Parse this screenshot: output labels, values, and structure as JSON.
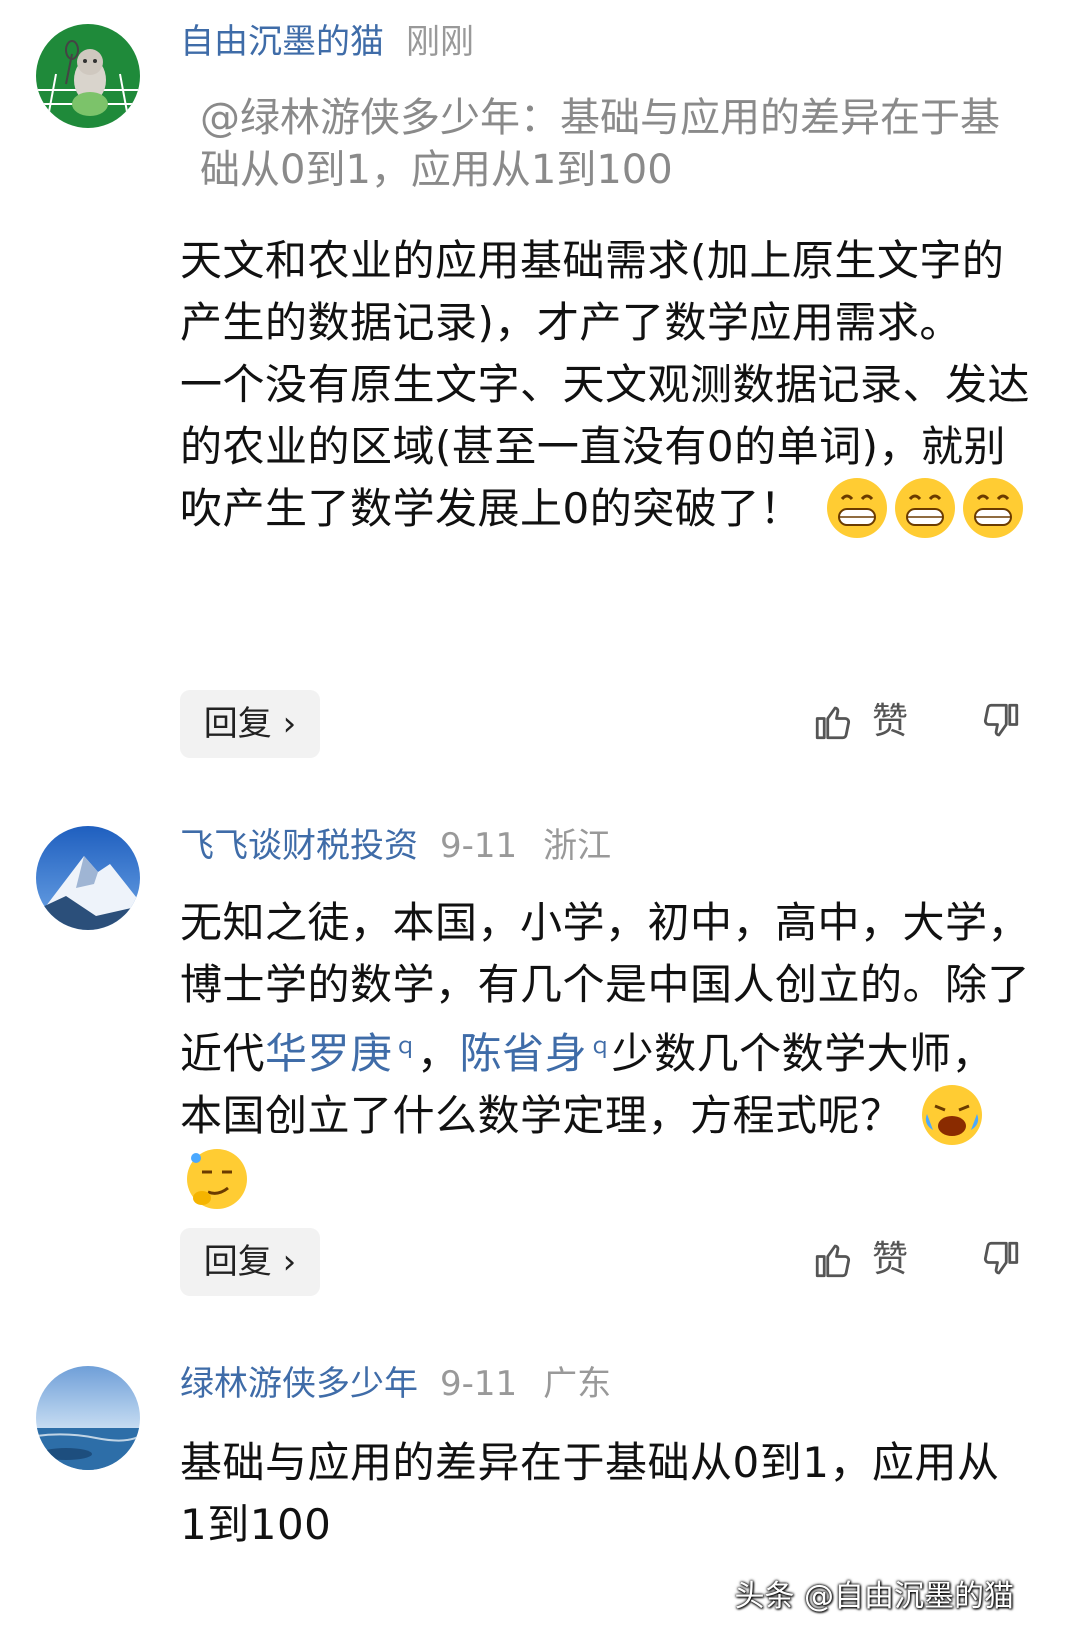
{
  "comments": [
    {
      "name": "自由沉墨的猫",
      "time": "刚刚",
      "quote": "@绿林游侠多少年：基础与应用的差异在于基础从0到1，应用从1到100",
      "body": "天文和农业的应用基础需求(加上原生文字的产生的数据记录)，才产了数学应用需求。\n一个没有原生文字、天文观测数据记录、发达的农业的区域(甚至一直没有0的单词)，就别吹产生了数学发展上0的突破了！",
      "reply_label": "回复",
      "like_label": "赞",
      "emojis": [
        "grin-emoji",
        "grin-emoji",
        "grin-emoji"
      ]
    },
    {
      "name": "飞飞谈财税投资",
      "time": "9-11",
      "region": "浙江",
      "body_before": "无知之徒，本国，小学，初中，高中，大学，博士学的数学，有几个是中国人创立的。除了近代",
      "link1": "华罗庚",
      "sep": "，",
      "link2": "陈省身",
      "body_after": "少数几个数学大师，本国创立了什么数学定理，方程式呢？",
      "reply_label": "回复",
      "like_label": "赞",
      "emojis": [
        "laugh-cry-emoji",
        "smug-emoji"
      ]
    },
    {
      "name": "绿林游侠多少年",
      "time": "9-11",
      "region": "广东",
      "body": "基础与应用的差异在于基础从0到1，应用从1到100"
    }
  ],
  "watermark": "头条 @自由沉墨的猫",
  "colors": {
    "name": "#3f6ca8",
    "meta": "#999999",
    "reply_bg": "#f2f2f2"
  }
}
